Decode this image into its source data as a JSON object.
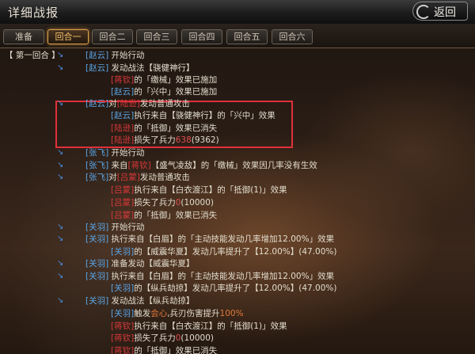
{
  "header": {
    "title": "详细战报",
    "back_label": "返回"
  },
  "tabs": [
    {
      "label": "准备",
      "active": false
    },
    {
      "label": "回合一",
      "active": true
    },
    {
      "label": "回合二",
      "active": false
    },
    {
      "label": "回合三",
      "active": false
    },
    {
      "label": "回合四",
      "active": false
    },
    {
      "label": "回合五",
      "active": false
    },
    {
      "label": "回合六",
      "active": false
    }
  ],
  "round_label": "【 第一回合 】",
  "colors": {
    "blue_name": "#5aa6e8",
    "enemy_name": "#d8383a",
    "highlight": "#e0303a",
    "active_tab": "#e0a44c"
  },
  "log": [
    {
      "parts": [
        {
          "t": "[赵云]",
          "c": "name"
        },
        {
          "t": " 开始行动",
          "c": "txt"
        }
      ]
    },
    {
      "parts": [
        {
          "t": "[赵云]",
          "c": "name"
        },
        {
          "t": " 发动战法【骁健神行】",
          "c": "txt"
        }
      ]
    },
    {
      "parts": [
        {
          "t": "[蒋钦]",
          "c": "enemy"
        },
        {
          "t": "的「缴械」效果已施加",
          "c": "txt"
        }
      ]
    },
    {
      "parts": [
        {
          "t": "[赵云]",
          "c": "name"
        },
        {
          "t": "的「兴中」效果已施加",
          "c": "txt"
        }
      ]
    },
    {
      "parts": [
        {
          "t": "[赵云]",
          "c": "name"
        },
        {
          "t": "对",
          "c": "txt"
        },
        {
          "t": "[陆逊]",
          "c": "enemy"
        },
        {
          "t": "发动普通攻击",
          "c": "txt"
        }
      ]
    },
    {
      "parts": [
        {
          "t": "[赵云]",
          "c": "name"
        },
        {
          "t": "执行来自【骁健神行】的「兴中」效果",
          "c": "txt"
        }
      ]
    },
    {
      "parts": [
        {
          "t": "[陆逊]",
          "c": "enemy"
        },
        {
          "t": "的「抵御」效果已消失",
          "c": "txt"
        }
      ]
    },
    {
      "parts": [
        {
          "t": "[陆逊]",
          "c": "enemy"
        },
        {
          "t": "损失了兵力",
          "c": "txt"
        },
        {
          "t": "638",
          "c": "dmg"
        },
        {
          "t": "(9362)",
          "c": "txt"
        }
      ]
    },
    {
      "parts": [
        {
          "t": "[张飞]",
          "c": "name"
        },
        {
          "t": " 开始行动",
          "c": "txt"
        }
      ]
    },
    {
      "parts": [
        {
          "t": "[张飞]",
          "c": "name"
        },
        {
          "t": " 来自",
          "c": "txt"
        },
        {
          "t": "[蒋钦]",
          "c": "enemy"
        },
        {
          "t": "【盛气凌敌】的「缴械」效果因几率没有生效",
          "c": "txt"
        }
      ]
    },
    {
      "parts": [
        {
          "t": "[张飞]",
          "c": "name"
        },
        {
          "t": "对",
          "c": "txt"
        },
        {
          "t": "[吕蒙]",
          "c": "enemy"
        },
        {
          "t": "发动普通攻击",
          "c": "txt"
        }
      ]
    },
    {
      "parts": [
        {
          "t": "[吕蒙]",
          "c": "enemy"
        },
        {
          "t": "执行来自【白衣渡江】的「抵御(1)」效果",
          "c": "txt"
        }
      ]
    },
    {
      "parts": [
        {
          "t": "[吕蒙]",
          "c": "enemy"
        },
        {
          "t": "损失了兵力",
          "c": "txt"
        },
        {
          "t": "0",
          "c": "dmg"
        },
        {
          "t": "(10000)",
          "c": "txt"
        }
      ]
    },
    {
      "parts": [
        {
          "t": "[吕蒙]",
          "c": "enemy"
        },
        {
          "t": "的「抵御」效果已消失",
          "c": "txt"
        }
      ]
    },
    {
      "parts": [
        {
          "t": "[关羽]",
          "c": "name"
        },
        {
          "t": " 开始行动",
          "c": "txt"
        }
      ]
    },
    {
      "parts": [
        {
          "t": "[关羽]",
          "c": "name"
        },
        {
          "t": " 执行来自【白眉】的「主动技能发动几率增加12.00%」效果",
          "c": "txt"
        }
      ]
    },
    {
      "parts": [
        {
          "t": "[关羽]",
          "c": "name"
        },
        {
          "t": "的【威震华夏】发动几率提升了【12.00%】(47.00%)",
          "c": "txt"
        }
      ]
    },
    {
      "parts": [
        {
          "t": "[关羽]",
          "c": "name"
        },
        {
          "t": " 准备发动【威震华夏】",
          "c": "txt"
        }
      ]
    },
    {
      "parts": [
        {
          "t": "[关羽]",
          "c": "name"
        },
        {
          "t": " 执行来自【白眉】的「主动技能发动几率增加12.00%」效果",
          "c": "txt"
        }
      ]
    },
    {
      "parts": [
        {
          "t": "[关羽]",
          "c": "name"
        },
        {
          "t": "的【纵兵劫掠】发动几率提升了【12.00%】(47.00%)",
          "c": "txt"
        }
      ]
    },
    {
      "parts": [
        {
          "t": "[关羽]",
          "c": "name"
        },
        {
          "t": " 发动战法【纵兵劫掠】",
          "c": "txt"
        }
      ]
    },
    {
      "parts": [
        {
          "t": "[关羽]",
          "c": "name"
        },
        {
          "t": "触发",
          "c": "txt"
        },
        {
          "t": "会心",
          "c": "pos"
        },
        {
          "t": ",兵刃伤害提升",
          "c": "txt"
        },
        {
          "t": "100%",
          "c": "pos"
        }
      ]
    },
    {
      "parts": [
        {
          "t": "[蒋钦]",
          "c": "enemy"
        },
        {
          "t": "执行来自【白衣渡江】的「抵御(1)」效果",
          "c": "txt"
        }
      ]
    },
    {
      "parts": [
        {
          "t": "[蒋钦]",
          "c": "enemy"
        },
        {
          "t": "损失了兵力",
          "c": "txt"
        },
        {
          "t": "0",
          "c": "dmg"
        },
        {
          "t": "(10000)",
          "c": "txt"
        }
      ]
    },
    {
      "parts": [
        {
          "t": "[蒋钦]",
          "c": "enemy"
        },
        {
          "t": "的「抵御」效果已消失",
          "c": "txt"
        }
      ]
    }
  ]
}
